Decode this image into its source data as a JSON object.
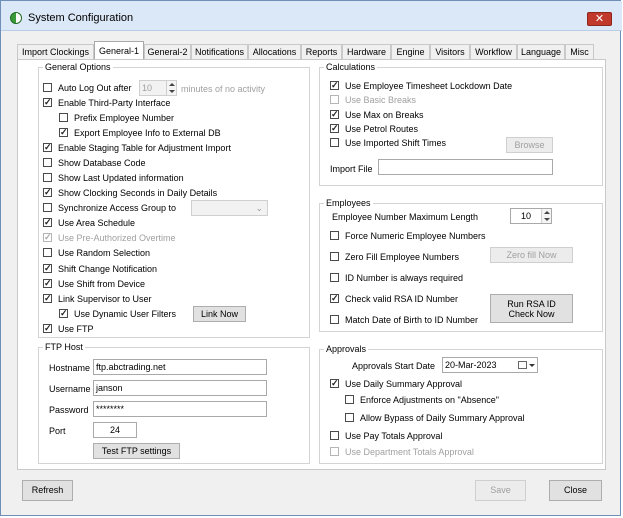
{
  "window": {
    "title": "System Configuration",
    "close_glyph": "✕"
  },
  "tabs": [
    {
      "label": "Import Clockings"
    },
    {
      "label": "General-1"
    },
    {
      "label": "General-2"
    },
    {
      "label": "Notifications"
    },
    {
      "label": "Allocations"
    },
    {
      "label": "Reports"
    },
    {
      "label": "Hardware"
    },
    {
      "label": "Engine"
    },
    {
      "label": "Visitors"
    },
    {
      "label": "Workflow"
    },
    {
      "label": "Language"
    },
    {
      "label": "Misc"
    }
  ],
  "active_tab": "General-1",
  "general_options": {
    "title": "General Options",
    "auto_logout_label": "Auto Log Out after",
    "auto_logout_value": "10",
    "auto_logout_suffix": "minutes of no activity",
    "items": [
      {
        "label": "Enable Third-Party Interface",
        "checked": true,
        "disabled": false
      },
      {
        "label": "Prefix Employee Number",
        "checked": false,
        "disabled": false
      },
      {
        "label": "Export Employee Info to External DB",
        "checked": true,
        "disabled": false
      },
      {
        "label": "Enable Staging Table for Adjustment Import",
        "checked": true,
        "disabled": false
      },
      {
        "label": "Show Database Code",
        "checked": false,
        "disabled": false
      },
      {
        "label": "Show Last Updated information",
        "checked": false,
        "disabled": false
      },
      {
        "label": "Show Clocking Seconds in Daily Details",
        "checked": true,
        "disabled": false
      },
      {
        "label": "Synchronize Access Group  to",
        "checked": false,
        "disabled": false
      },
      {
        "label": "Use Area Schedule",
        "checked": true,
        "disabled": false
      },
      {
        "label": "Use Pre-Authorized Overtime",
        "checked": true,
        "disabled": true
      },
      {
        "label": "Use Random Selection",
        "checked": false,
        "disabled": false
      },
      {
        "label": "Shift Change Notification",
        "checked": true,
        "disabled": false
      },
      {
        "label": "Use Shift from Device",
        "checked": true,
        "disabled": false
      },
      {
        "label": "Link Supervisor to User",
        "checked": true,
        "disabled": false
      },
      {
        "label": "Use Dynamic User Filters",
        "checked": true,
        "disabled": false
      },
      {
        "label": "Use FTP",
        "checked": true,
        "disabled": false
      }
    ],
    "link_now_label": "Link Now"
  },
  "ftp_host": {
    "title": "FTP Host",
    "hostname_label": "Hostname",
    "hostname_value": "ftp.abctrading.net",
    "username_label": "Username",
    "username_value": "janson",
    "password_label": "Password",
    "password_value": "********",
    "port_label": "Port",
    "port_value": "24",
    "test_button": "Test FTP settings"
  },
  "calculations": {
    "title": "Calculations",
    "items": [
      {
        "label": "Use Employee Timesheet Lockdown Date",
        "checked": true,
        "disabled": false
      },
      {
        "label": "Use Basic Breaks",
        "checked": false,
        "disabled": true
      },
      {
        "label": "Use Max on Breaks",
        "checked": true,
        "disabled": false
      },
      {
        "label": "Use Petrol Routes",
        "checked": true,
        "disabled": false
      },
      {
        "label": "Use Imported Shift Times",
        "checked": false,
        "disabled": false
      }
    ],
    "browse_label": "Browse",
    "import_file_label": "Import File",
    "import_file_value": ""
  },
  "employees": {
    "title": "Employees",
    "max_length_label": "Employee Number Maximum Length",
    "max_length_value": "10",
    "items": [
      {
        "label": "Force Numeric Employee Numbers",
        "checked": false,
        "disabled": false
      },
      {
        "label": "Zero Fill Employee Numbers",
        "checked": false,
        "disabled": false
      },
      {
        "label": "ID Number is always required",
        "checked": false,
        "disabled": false
      },
      {
        "label": "Check valid RSA ID Number",
        "checked": true,
        "disabled": false
      },
      {
        "label": "Match Date of Birth to ID Number",
        "checked": false,
        "disabled": false
      }
    ],
    "zero_fill_button": "Zero fill Now",
    "run_rsa_line1": "Run RSA ID",
    "run_rsa_line2": "Check Now"
  },
  "approvals": {
    "title": "Approvals",
    "start_date_label": "Approvals Start Date",
    "start_date_value": "20-Mar-2023",
    "items": [
      {
        "label": "Use Daily Summary Approval",
        "checked": true,
        "disabled": false
      },
      {
        "label": "Enforce Adjustments on \"Absence\"",
        "checked": false,
        "disabled": false
      },
      {
        "label": "Allow Bypass of Daily Summary Approval",
        "checked": false,
        "disabled": false
      },
      {
        "label": "Use Pay Totals Approval",
        "checked": false,
        "disabled": false
      },
      {
        "label": "Use Department Totals Approval",
        "checked": false,
        "disabled": true
      }
    ]
  },
  "footer": {
    "refresh": "Refresh",
    "save": "Save",
    "close": "Close"
  }
}
